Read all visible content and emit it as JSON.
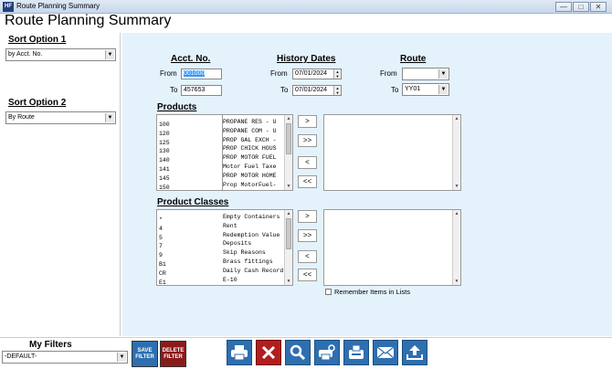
{
  "window": {
    "title": "Route Planning Summary",
    "app_icon": "app-logo-icon",
    "minimize": "minimize-icon",
    "restore": "restore-icon",
    "close": "close-icon"
  },
  "page": {
    "title": "Route Planning Summary"
  },
  "sort1": {
    "label": "Sort Option 1",
    "value": "by Acct. No."
  },
  "sort2": {
    "label": "Sort Option 2",
    "value": "By Route"
  },
  "acct": {
    "heading": "Acct. No.",
    "from_label": "From",
    "from_value": "001000",
    "to_label": "To",
    "to_value": "457653"
  },
  "history": {
    "heading": "History Dates",
    "from_label": "From",
    "from_value": "07/01/2024",
    "to_label": "To",
    "to_value": "07/01/2024"
  },
  "route": {
    "heading": "Route",
    "from_label": "From",
    "from_value": "",
    "to_label": "To",
    "to_value": "YY01"
  },
  "products": {
    "heading": "Products",
    "items": [
      {
        "code": "100",
        "desc": "PROPANE RES - U"
      },
      {
        "code": "120",
        "desc": "PROPANE COM - U"
      },
      {
        "code": "125",
        "desc": "PROP GAL EXCH -"
      },
      {
        "code": "130",
        "desc": "PROP CHICK HOUS"
      },
      {
        "code": "140",
        "desc": "PROP MOTOR FUEL"
      },
      {
        "code": "141",
        "desc": "Motor Fuel Taxe"
      },
      {
        "code": "145",
        "desc": "PROP MOTOR HOME"
      },
      {
        "code": "150",
        "desc": "Prop MotorFuel-"
      }
    ]
  },
  "classes": {
    "heading": "Product Classes",
    "items": [
      {
        "code": "*",
        "desc": "Empty Containers"
      },
      {
        "code": "4",
        "desc": "Rent"
      },
      {
        "code": "5",
        "desc": "Redemption Value"
      },
      {
        "code": "7",
        "desc": "Deposits"
      },
      {
        "code": "9",
        "desc": "Skip Reasons"
      },
      {
        "code": "B1",
        "desc": "Brass fittings"
      },
      {
        "code": "CR",
        "desc": "Daily Cash Recording"
      },
      {
        "code": "E1",
        "desc": "E-10"
      }
    ]
  },
  "move": {
    "add_one": ">",
    "add_all": ">>",
    "remove_one": "<",
    "remove_all": "<<"
  },
  "remember": {
    "label": "Remember Items in Lists",
    "checked": false
  },
  "filters": {
    "label": "My Filters",
    "value": "-DEFAULT-",
    "save": "SAVE FILTER",
    "delete": "DELETE FILTER",
    "save_color": "#2e6fb0",
    "delete_color": "#8b1a1a"
  },
  "toolbar": {
    "icons": [
      "print-icon",
      "cancel-icon",
      "search-icon",
      "print-preview-icon",
      "fax-icon",
      "email-icon",
      "export-icon"
    ]
  }
}
